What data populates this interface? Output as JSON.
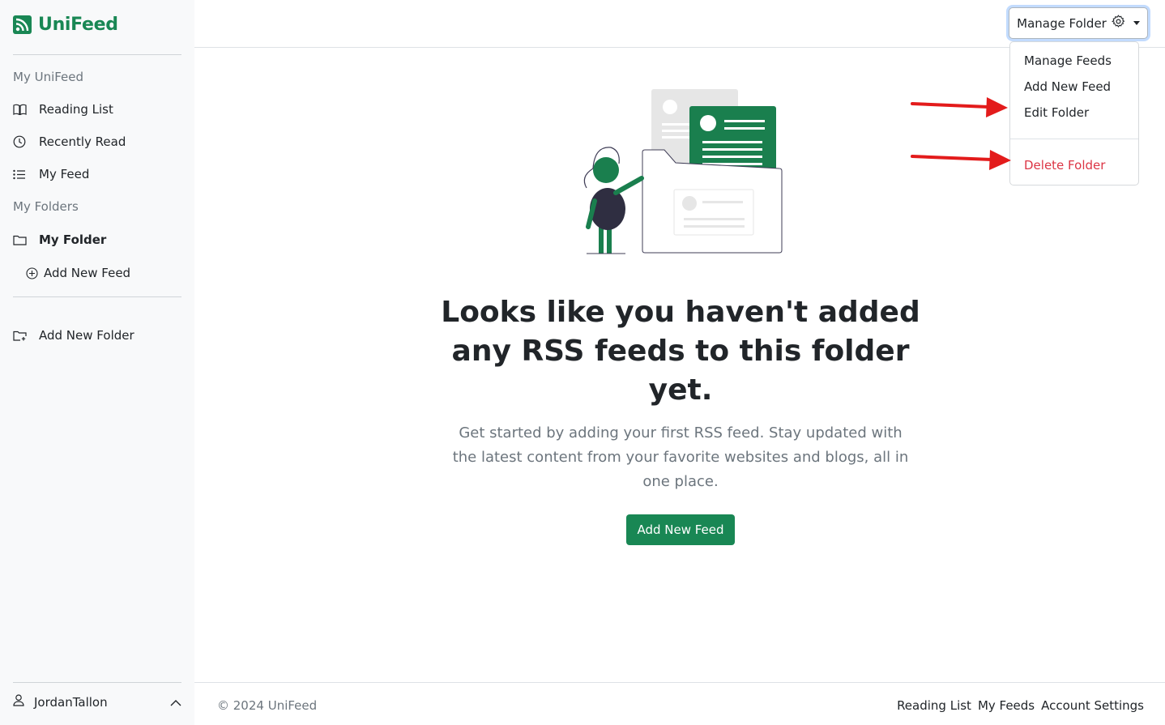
{
  "brand": {
    "name": "UniFeed",
    "color": "#198754",
    "icon": "rss-icon"
  },
  "sidebar": {
    "section_main": "My UniFeed",
    "items": [
      {
        "label": "Reading List",
        "icon": "book-icon"
      },
      {
        "label": "Recently Read",
        "icon": "clock-icon"
      },
      {
        "label": "My Feed",
        "icon": "list-icon"
      }
    ],
    "section_folders": "My Folders",
    "folder": {
      "label": "My Folder",
      "icon": "folder-icon"
    },
    "folder_add_feed": {
      "label": "Add New Feed",
      "icon": "plus-circle-icon"
    },
    "add_folder": {
      "label": "Add New Folder",
      "icon": "folder-plus-icon"
    },
    "user": {
      "name": "JordanTallon",
      "icon": "person-icon"
    }
  },
  "toolbar": {
    "manage_label": "Manage Folder",
    "menu": [
      "Manage Feeds",
      "Add New Feed",
      "Edit Folder"
    ],
    "danger_item": "Delete Folder",
    "danger_color": "#dc3545"
  },
  "empty_state": {
    "headline": "Looks like you haven't added any RSS feeds to this folder yet.",
    "body": "Get started by adding your first RSS feed. Stay updated with the latest content from your favorite websites and blogs, all in one place.",
    "cta": "Add New Feed"
  },
  "footer": {
    "copyright": "© 2024 UniFeed",
    "links": [
      "Reading List",
      "My Feeds",
      "Account Settings"
    ]
  },
  "annotations": {
    "arrow_color": "#e31b1b"
  }
}
